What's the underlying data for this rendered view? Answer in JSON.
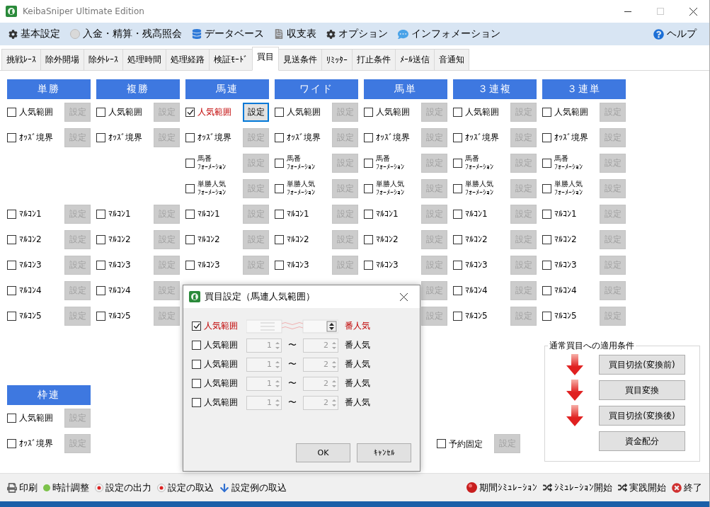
{
  "window": {
    "title": "KeibaSniper Ultimate Edition"
  },
  "menu": [
    {
      "label": "基本設定"
    },
    {
      "label": "入金・精算・残高照会"
    },
    {
      "label": "データベース"
    },
    {
      "label": "収支表"
    },
    {
      "label": "オプション"
    },
    {
      "label": "インフォメーション"
    }
  ],
  "help": "ヘルプ",
  "tabs": [
    {
      "label": "挑戦ﾚｰｽ",
      "selected": false
    },
    {
      "label": "除外開場",
      "selected": false
    },
    {
      "label": "除外ﾚｰｽ",
      "selected": false
    },
    {
      "label": "処理時間",
      "selected": false
    },
    {
      "label": "処理経路",
      "selected": false
    },
    {
      "label": "検証ﾓｰﾄﾞ",
      "selected": false
    },
    {
      "label": "買目",
      "selected": true
    },
    {
      "label": "見送条件",
      "selected": false
    },
    {
      "label": "ﾘﾐｯﾀｰ",
      "selected": false
    },
    {
      "label": "打止条件",
      "selected": false
    },
    {
      "label": "ﾒｰﾙ送信",
      "selected": false
    },
    {
      "label": "音通知",
      "selected": false
    }
  ],
  "columns": [
    {
      "title": "単勝",
      "items": [
        {
          "kind": "check",
          "label": "人気範囲",
          "checked": false,
          "button": "設定"
        },
        {
          "kind": "check",
          "label": "ｵｯｽﾞ境界",
          "checked": false,
          "button": "設定"
        },
        {
          "kind": "empty"
        },
        {
          "kind": "empty"
        },
        {
          "kind": "check",
          "label": "ﾏﾙｺﾝ1",
          "checked": false,
          "button": "設定"
        },
        {
          "kind": "check",
          "label": "ﾏﾙｺﾝ2",
          "checked": false,
          "button": "設定"
        },
        {
          "kind": "check",
          "label": "ﾏﾙｺﾝ3",
          "checked": false,
          "button": "設定"
        },
        {
          "kind": "check",
          "label": "ﾏﾙｺﾝ4",
          "checked": false,
          "button": "設定"
        },
        {
          "kind": "check",
          "label": "ﾏﾙｺﾝ5",
          "checked": false,
          "button": "設定"
        }
      ]
    },
    {
      "title": "複勝",
      "items": [
        {
          "kind": "check",
          "label": "人気範囲",
          "checked": false,
          "button": "設定"
        },
        {
          "kind": "check",
          "label": "ｵｯｽﾞ境界",
          "checked": false,
          "button": "設定"
        },
        {
          "kind": "empty"
        },
        {
          "kind": "empty"
        },
        {
          "kind": "check",
          "label": "ﾏﾙｺﾝ1",
          "checked": false,
          "button": "設定"
        },
        {
          "kind": "check",
          "label": "ﾏﾙｺﾝ2",
          "checked": false,
          "button": "設定"
        },
        {
          "kind": "check",
          "label": "ﾏﾙｺﾝ3",
          "checked": false,
          "button": "設定"
        },
        {
          "kind": "check",
          "label": "ﾏﾙｺﾝ4",
          "checked": false,
          "button": "設定"
        },
        {
          "kind": "check",
          "label": "ﾏﾙｺﾝ5",
          "checked": false,
          "button": "設定"
        }
      ]
    },
    {
      "title": "馬連",
      "items": [
        {
          "kind": "check",
          "label": "人気範囲",
          "checked": true,
          "button": "設定"
        },
        {
          "kind": "check",
          "label": "ｵｯｽﾞ境界",
          "checked": false,
          "button": "設定"
        },
        {
          "kind": "check",
          "label": "馬番",
          "label_line2": "ﾌｫｰﾒｰｼｮﾝ",
          "checked": false,
          "button": "設定"
        },
        {
          "kind": "check",
          "label": "単勝人気",
          "label_line2": "ﾌｫｰﾒｰｼｮﾝ",
          "checked": false,
          "button": "設定"
        },
        {
          "kind": "check",
          "label": "ﾏﾙｺﾝ1",
          "checked": false,
          "button": "設定"
        },
        {
          "kind": "check",
          "label": "ﾏﾙｺﾝ2",
          "checked": false,
          "button": "設定"
        },
        {
          "kind": "check",
          "label": "ﾏﾙｺﾝ3",
          "checked": false,
          "button": "設定"
        },
        {
          "kind": "empty"
        },
        {
          "kind": "empty"
        }
      ]
    },
    {
      "title": "ワイド",
      "items": [
        {
          "kind": "check",
          "label": "人気範囲",
          "checked": false,
          "button": "設定"
        },
        {
          "kind": "check",
          "label": "ｵｯｽﾞ境界",
          "checked": false,
          "button": "設定"
        },
        {
          "kind": "check",
          "label": "馬番",
          "label_line2": "ﾌｫｰﾒｰｼｮﾝ",
          "checked": false,
          "button": "設定"
        },
        {
          "kind": "check",
          "label": "単勝人気",
          "label_line2": "ﾌｫｰﾒｰｼｮﾝ",
          "checked": false,
          "button": "設定"
        },
        {
          "kind": "check",
          "label": "ﾏﾙｺﾝ1",
          "checked": false,
          "button": "設定"
        },
        {
          "kind": "check",
          "label": "ﾏﾙｺﾝ2",
          "checked": false,
          "button": "設定"
        },
        {
          "kind": "check",
          "label": "ﾏﾙｺﾝ3",
          "checked": false,
          "button": "設定"
        },
        {
          "kind": "empty"
        },
        {
          "kind": "empty"
        }
      ]
    },
    {
      "title": "馬単",
      "items": [
        {
          "kind": "check",
          "label": "人気範囲",
          "checked": false,
          "button": "設定"
        },
        {
          "kind": "check",
          "label": "ｵｯｽﾞ境界",
          "checked": false,
          "button": "設定"
        },
        {
          "kind": "check",
          "label": "馬番",
          "label_line2": "ﾌｫｰﾒｰｼｮﾝ",
          "checked": false,
          "button": "設定"
        },
        {
          "kind": "check",
          "label": "単勝人気",
          "label_line2": "ﾌｫｰﾒｰｼｮﾝ",
          "checked": false,
          "button": "設定"
        },
        {
          "kind": "check",
          "label": "ﾏﾙｺﾝ1",
          "checked": false,
          "button": "設定"
        },
        {
          "kind": "check",
          "label": "ﾏﾙｺﾝ2",
          "checked": false,
          "button": "設定"
        },
        {
          "kind": "check",
          "label": "ﾏﾙｺﾝ3",
          "checked": false,
          "button": "設定"
        },
        {
          "kind": "button",
          "disabled": true,
          "button": "設定"
        },
        {
          "kind": "button",
          "disabled": true,
          "button": "設定"
        }
      ]
    },
    {
      "title": "３連複",
      "items": [
        {
          "kind": "check",
          "label": "人気範囲",
          "checked": false,
          "button": "設定"
        },
        {
          "kind": "check",
          "label": "ｵｯｽﾞ境界",
          "checked": false,
          "button": "設定"
        },
        {
          "kind": "check",
          "label": "馬番",
          "label_line2": "ﾌｫｰﾒｰｼｮﾝ",
          "checked": false,
          "button": "設定"
        },
        {
          "kind": "check",
          "label": "単勝人気",
          "label_line2": "ﾌｫｰﾒｰｼｮﾝ",
          "checked": false,
          "button": "設定"
        },
        {
          "kind": "check",
          "label": "ﾏﾙｺﾝ1",
          "checked": false,
          "button": "設定"
        },
        {
          "kind": "check",
          "label": "ﾏﾙｺﾝ2",
          "checked": false,
          "button": "設定"
        },
        {
          "kind": "check",
          "label": "ﾏﾙｺﾝ3",
          "checked": false,
          "button": "設定"
        },
        {
          "kind": "check",
          "label": "ﾏﾙｺﾝ4",
          "checked": false,
          "button": "設定"
        },
        {
          "kind": "check",
          "label": "ﾏﾙｺﾝ5",
          "checked": false,
          "button": "設定"
        }
      ]
    },
    {
      "title": "３連単",
      "items": [
        {
          "kind": "check",
          "label": "人気範囲",
          "checked": false,
          "button": "設定"
        },
        {
          "kind": "check",
          "label": "ｵｯｽﾞ境界",
          "checked": false,
          "button": "設定"
        },
        {
          "kind": "check",
          "label": "馬番",
          "label_line2": "ﾌｫｰﾒｰｼｮﾝ",
          "checked": false,
          "button": "設定"
        },
        {
          "kind": "check",
          "label": "単勝人気",
          "label_line2": "ﾌｫｰﾒｰｼｮﾝ",
          "checked": false,
          "button": "設定"
        },
        {
          "kind": "check",
          "label": "ﾏﾙｺﾝ1",
          "checked": false,
          "button": "設定"
        },
        {
          "kind": "check",
          "label": "ﾏﾙｺﾝ2",
          "checked": false,
          "button": "設定"
        },
        {
          "kind": "check",
          "label": "ﾏﾙｺﾝ3",
          "checked": false,
          "button": "設定"
        },
        {
          "kind": "check",
          "label": "ﾏﾙｺﾝ4",
          "checked": false,
          "button": "設定"
        },
        {
          "kind": "check",
          "label": "ﾏﾙｺﾝ5",
          "checked": false,
          "button": "設定"
        }
      ]
    }
  ],
  "wakuren": {
    "title": "枠連",
    "items": [
      {
        "kind": "check",
        "label": "人気範囲",
        "checked": false,
        "button": "設定"
      },
      {
        "kind": "check",
        "label": "ｵｯｽﾞ境界",
        "checked": false,
        "button": "設定"
      }
    ]
  },
  "reservation": {
    "label": "予約固定",
    "checked": false,
    "button": "設定"
  },
  "apply_group": {
    "title": "通常買目への適用条件",
    "steps": [
      "買目切捨(変換前)",
      "買目変換",
      "買目切捨(変換後)",
      "資金配分"
    ]
  },
  "toolbar_left": [
    {
      "label": "印刷"
    },
    {
      "label": "時計調整"
    },
    {
      "label": "設定の出力"
    },
    {
      "label": "設定の取込"
    },
    {
      "label": "設定例の取込"
    }
  ],
  "toolbar_right": [
    {
      "label": "期間ｼﾐｭﾚｰｼｮﾝ"
    },
    {
      "label": "ｼﾐｭﾚｰｼｮﾝ開始"
    },
    {
      "label": "実践開始"
    },
    {
      "label": "終了"
    }
  ],
  "dialog": {
    "title": "買目設定（馬連人気範囲）",
    "rows": [
      {
        "label": "人気範囲",
        "checked": true,
        "suffix": "番人気"
      },
      {
        "label": "人気範囲",
        "checked": false,
        "from": "1",
        "separator": "〜",
        "to": "2",
        "suffix": "番人気"
      },
      {
        "label": "人気範囲",
        "checked": false,
        "from": "1",
        "separator": "〜",
        "to": "2",
        "suffix": "番人気"
      },
      {
        "label": "人気範囲",
        "checked": false,
        "from": "1",
        "separator": "〜",
        "to": "2",
        "suffix": "番人気"
      },
      {
        "label": "人気範囲",
        "checked": false,
        "from": "1",
        "separator": "〜",
        "to": "2",
        "suffix": "番人気"
      }
    ],
    "buttons": [
      "OK",
      "ｷｬﾝｾﾙ"
    ]
  }
}
